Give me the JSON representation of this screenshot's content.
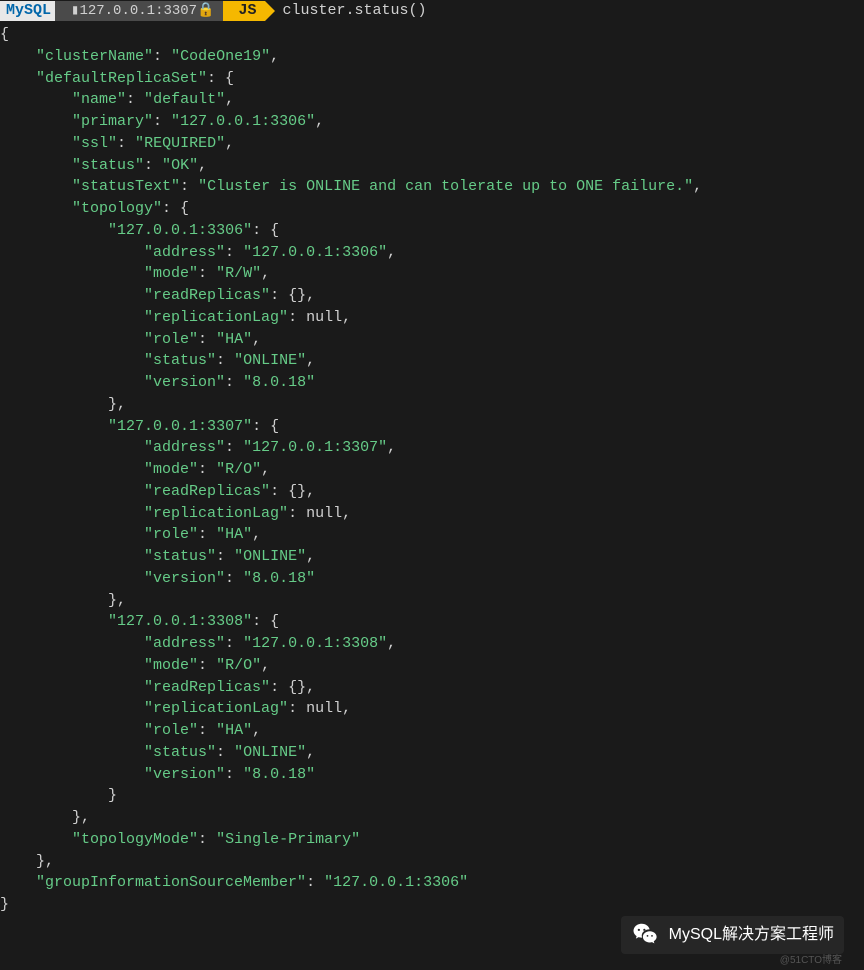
{
  "prompt": {
    "mysql": "MySQL",
    "host": "127.0.0.1:3307",
    "mode": "JS",
    "command": "cluster.status()"
  },
  "output": {
    "clusterName": "CodeOne19",
    "defaultReplicaSet": {
      "name": "default",
      "primary": "127.0.0.1:3306",
      "ssl": "REQUIRED",
      "status": "OK",
      "statusText": "Cluster is ONLINE and can tolerate up to ONE failure.",
      "topology": {
        "node1": {
          "key": "127.0.0.1:3306",
          "address": "127.0.0.1:3306",
          "mode": "R/W",
          "readReplicas": "{}",
          "replicationLag": "null",
          "role": "HA",
          "status": "ONLINE",
          "version": "8.0.18"
        },
        "node2": {
          "key": "127.0.0.1:3307",
          "address": "127.0.0.1:3307",
          "mode": "R/O",
          "readReplicas": "{}",
          "replicationLag": "null",
          "role": "HA",
          "status": "ONLINE",
          "version": "8.0.18"
        },
        "node3": {
          "key": "127.0.0.1:3308",
          "address": "127.0.0.1:3308",
          "mode": "R/O",
          "readReplicas": "{}",
          "replicationLag": "null",
          "role": "HA",
          "status": "ONLINE",
          "version": "8.0.18"
        }
      },
      "topologyMode": "Single-Primary"
    },
    "groupInformationSourceMember": "127.0.0.1:3306"
  },
  "watermark": {
    "text": "MySQL解决方案工程师",
    "sub": "@51CTO博客"
  }
}
